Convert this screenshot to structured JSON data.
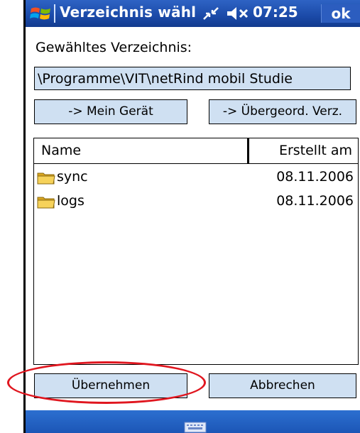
{
  "window": {
    "title": "Verzeichnis wähle",
    "time": "07:25",
    "ok_label": "ok",
    "icons": [
      "windows-flag-icon",
      "connectivity-icon",
      "volume-muted-icon"
    ]
  },
  "dialog": {
    "selected_dir_label": "Gewähltes Verzeichnis:",
    "path_value": "\\Programme\\VIT\\netRind mobil Studie",
    "my_device_button": "-> Mein Gerät",
    "parent_dir_button": "-> Übergeord. Verz."
  },
  "list": {
    "columns": [
      "Name",
      "Erstellt am"
    ],
    "rows": [
      {
        "name": "sync",
        "created": "08.11.2006",
        "icon": "folder-icon"
      },
      {
        "name": "logs",
        "created": "08.11.2006",
        "icon": "folder-icon"
      }
    ]
  },
  "actions": {
    "apply_button": "Übernehmen",
    "cancel_button": "Abbrechen"
  },
  "taskbar": {
    "icon": "keyboard-icon"
  },
  "colors": {
    "titlebar": "#1b4aa8",
    "button_face": "#cfe0f2",
    "highlight_annotation": "#e0161f"
  }
}
